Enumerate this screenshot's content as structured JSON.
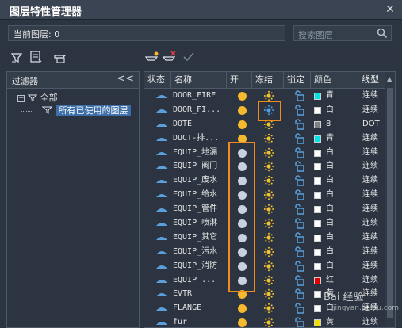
{
  "window": {
    "title": "图层特性管理器",
    "close": "✕"
  },
  "current_layer": "当前图层: 0",
  "search": {
    "placeholder": "搜索图层"
  },
  "filter_pane": {
    "header": "过滤器",
    "collapse": "<<",
    "tree": [
      {
        "label": "全部"
      },
      {
        "label": "所有已使用的图层"
      }
    ]
  },
  "columns": [
    "状态",
    "名称",
    "开",
    "冻结",
    "锁定",
    "颜色",
    "线型"
  ],
  "layers": [
    {
      "name": "DOOR_FIRE",
      "on": true,
      "color_hex": "#00e5e5",
      "color_name": "青",
      "linetype": "连续"
    },
    {
      "name": "DOOR_FI...",
      "on": true,
      "color_hex": "#ffffff",
      "color_name": "白",
      "linetype": "连续"
    },
    {
      "name": "DOTE",
      "on": true,
      "color_hex": "#808080",
      "color_name": "8",
      "linetype": "DOT"
    },
    {
      "name": "DUCT-排...",
      "on": true,
      "color_hex": "#00e5e5",
      "color_name": "青",
      "linetype": "连续"
    },
    {
      "name": "EQUIP_地漏",
      "on": false,
      "color_hex": "#ffffff",
      "color_name": "白",
      "linetype": "连续"
    },
    {
      "name": "EQUIP_阀门",
      "on": false,
      "color_hex": "#ffffff",
      "color_name": "白",
      "linetype": "连续"
    },
    {
      "name": "EQUIP_废水",
      "on": false,
      "color_hex": "#ffffff",
      "color_name": "白",
      "linetype": "连续"
    },
    {
      "name": "EQUIP_给水",
      "on": false,
      "color_hex": "#ffffff",
      "color_name": "白",
      "linetype": "连续"
    },
    {
      "name": "EQUIP_管件",
      "on": false,
      "color_hex": "#ffffff",
      "color_name": "白",
      "linetype": "连续"
    },
    {
      "name": "EQUIP_喷淋",
      "on": false,
      "color_hex": "#ffffff",
      "color_name": "白",
      "linetype": "连续"
    },
    {
      "name": "EQUIP_其它",
      "on": false,
      "color_hex": "#ffffff",
      "color_name": "白",
      "linetype": "连续"
    },
    {
      "name": "EQUIP_污水",
      "on": false,
      "color_hex": "#ffffff",
      "color_name": "白",
      "linetype": "连续"
    },
    {
      "name": "EQUIP_消防",
      "on": false,
      "color_hex": "#ffffff",
      "color_name": "白",
      "linetype": "连续"
    },
    {
      "name": "EQUIP_...",
      "on": false,
      "color_hex": "#e00000",
      "color_name": "红",
      "linetype": "连续"
    },
    {
      "name": "EVTR",
      "on": true,
      "color_hex": "#ffffff",
      "color_name": "黄",
      "linetype": "连续"
    },
    {
      "name": "FLANGE",
      "on": true,
      "color_hex": "#ffffff",
      "color_name": "白",
      "linetype": "连续"
    },
    {
      "name": "fur",
      "on": true,
      "color_hex": "#f0e000",
      "color_name": "黄",
      "linetype": "连续"
    }
  ],
  "watermark": {
    "text": "Bai 经验",
    "sub": "jingyan.baidu.com"
  },
  "colors": {
    "accent": "#f08c1e",
    "on_bulb": "#f5b82e",
    "off_bulb": "#c8d2de",
    "layer_icon": "#5aa0dc"
  }
}
